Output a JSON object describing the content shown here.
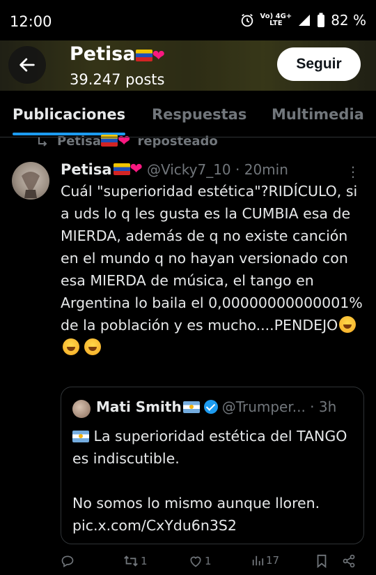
{
  "status_bar": {
    "time": "12:00",
    "signal_label_top": "Vo) 4G+",
    "signal_label_bottom": "LTE",
    "battery": "82 %",
    "icons": [
      "alarm-icon",
      "signal-icon",
      "battery-icon"
    ]
  },
  "header": {
    "name": "Petisa",
    "posts": "39.247 posts",
    "follow_label": "Seguir",
    "background_color": "#3c3b1c"
  },
  "tabs": [
    {
      "label": "Publicaciones",
      "active": true
    },
    {
      "label": "Respuestas",
      "active": false
    },
    {
      "label": "Multimedia",
      "active": false
    }
  ],
  "repost": {
    "user": "Petisa",
    "text": "reposteado"
  },
  "tweet": {
    "name": "Petisa",
    "handle": "@Vicky7_10 · 20min",
    "text": "Cuál \"superioridad estética\"?RIDÍCULO, si a uds lo q les gusta es la CUMBIA esa de MIERDA, además de q no existe canción en el mundo q no hayan versionado con esa MIERDA de música, el tango en Argentina lo baila el 0,00000000000001% de la población y es mucho....PENDEJO"
  },
  "quote": {
    "name": "Mati Smith",
    "handle": "@Trumper... · 3h",
    "line1": "La superioridad estética del TANGO es indiscutible.",
    "line2": "No somos lo mismo aunque lloren.",
    "link": "pic.x.com/CxYdu6n3S2"
  },
  "actions": {
    "reply_count": "",
    "retweet_count": "1",
    "like_count": "1",
    "views_count": "17"
  },
  "colors": {
    "accent": "#1d9bf0",
    "muted": "#71767b",
    "text": "#e7e9ea"
  }
}
